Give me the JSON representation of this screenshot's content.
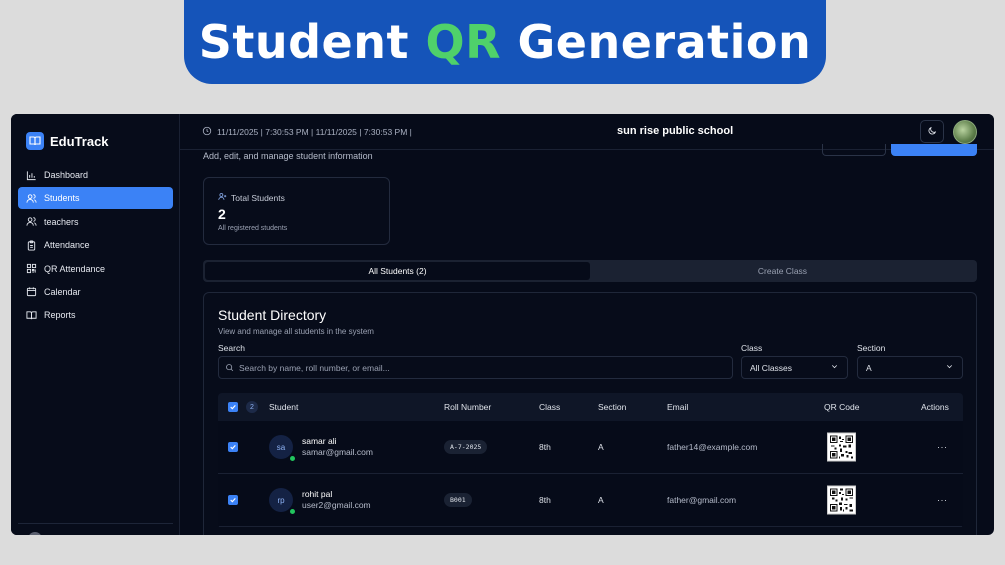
{
  "banner": {
    "title_pre": "Student ",
    "title_accent": "QR",
    "title_post": " Generation"
  },
  "app": {
    "logo": "EduTrack"
  },
  "sidebar": {
    "items": [
      {
        "label": "Dashboard",
        "icon": "bar-chart-icon"
      },
      {
        "label": "Students",
        "icon": "users-icon",
        "active": true
      },
      {
        "label": "teachers",
        "icon": "user-group-icon"
      },
      {
        "label": "Attendance",
        "icon": "clipboard-icon"
      },
      {
        "label": "QR Attendance",
        "icon": "qr-code-icon"
      },
      {
        "label": "Calendar",
        "icon": "calendar-icon"
      },
      {
        "label": "Reports",
        "icon": "book-icon"
      }
    ]
  },
  "topbar": {
    "datetime": "11/11/2025 | 7:30:53 PM | 11/11/2025 | 7:30:53 PM |",
    "school": "sun rise public school"
  },
  "page": {
    "subtitle": "Add, edit, and manage student information"
  },
  "stats": {
    "label": "Total Students",
    "value": "2",
    "sub": "All registered students"
  },
  "tabs": [
    {
      "label": "All Students (2)",
      "active": true
    },
    {
      "label": "Create Class",
      "active": false
    }
  ],
  "directory": {
    "title": "Student Directory",
    "subtitle": "View and manage all students in the system",
    "search_label": "Search",
    "search_placeholder": "Search by name, roll number, or email...",
    "class_label": "Class",
    "class_value": "All Classes",
    "section_label": "Section",
    "section_value": "A"
  },
  "table": {
    "selected_count": "2",
    "headers": {
      "student": "Student",
      "roll": "Roll Number",
      "class": "Class",
      "section": "Section",
      "email": "Email",
      "qr": "QR Code",
      "actions": "Actions"
    },
    "rows": [
      {
        "initials": "sa",
        "name": "samar ali",
        "student_email": "samar@gmail.com",
        "roll": "A-7-2025",
        "class": "8th",
        "section": "A",
        "email": "father14@example.com",
        "actions": "···"
      },
      {
        "initials": "rp",
        "name": "rohit pal",
        "student_email": "user2@gmail.com",
        "roll": "B001",
        "class": "8th",
        "section": "A",
        "email": "father@gmail.com",
        "actions": "···"
      }
    ]
  },
  "colors": {
    "accent": "#3b82f6",
    "banner": "#1554b9",
    "banner_accent": "#4fd16a",
    "background": "#060b19"
  }
}
